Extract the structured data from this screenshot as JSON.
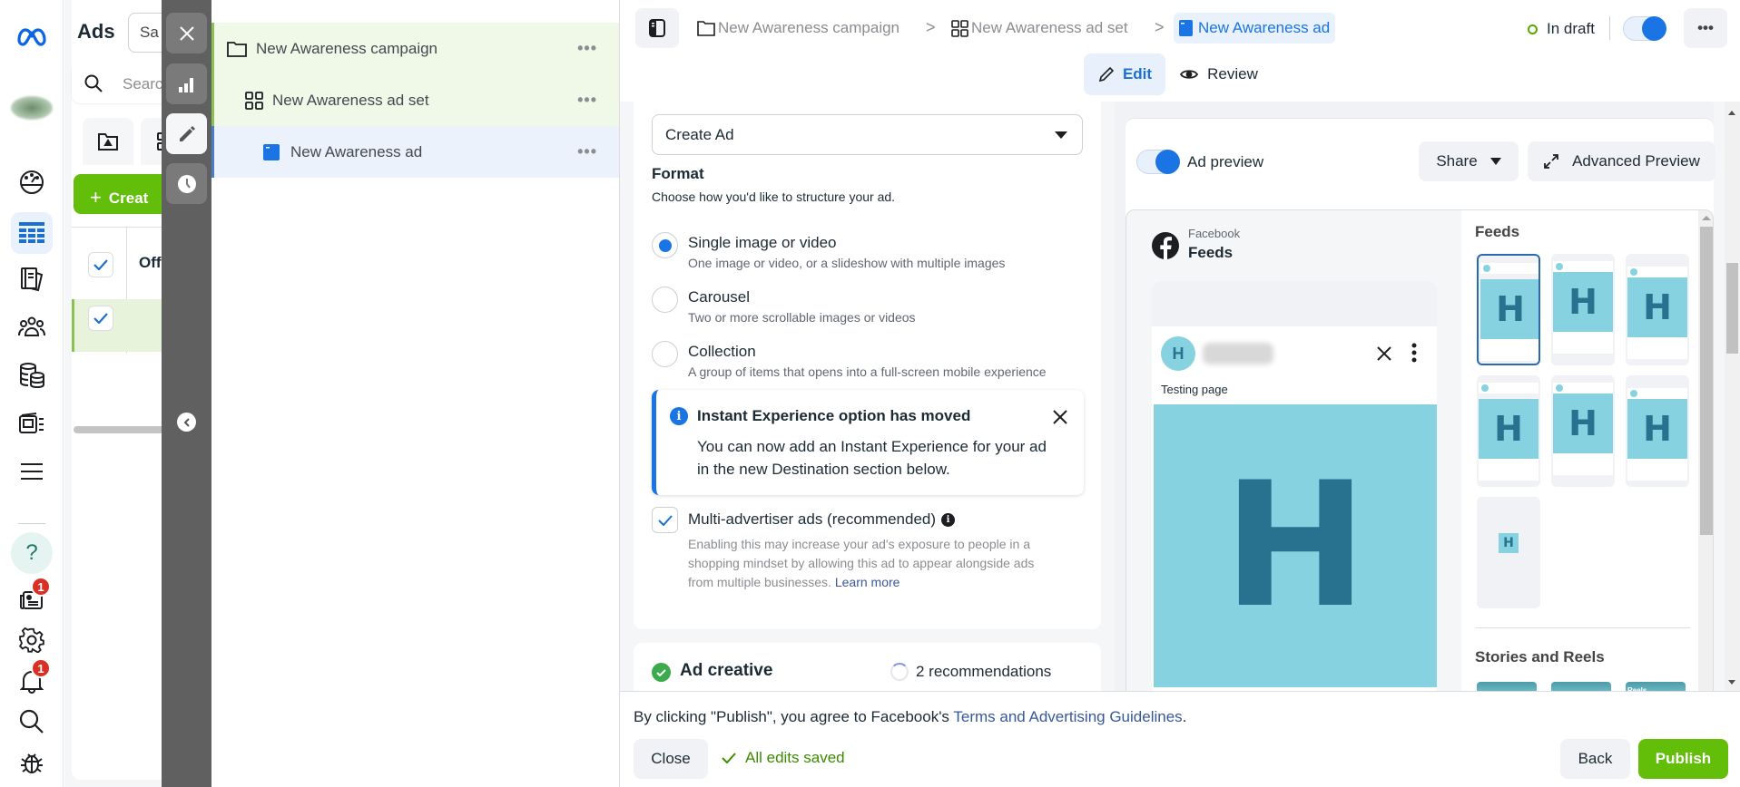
{
  "left_nav": {
    "items": [
      {
        "name": "meta-logo",
        "label": "Meta"
      },
      {
        "name": "account-avatar",
        "label": "Account"
      },
      {
        "name": "dashboard",
        "label": "Overview"
      },
      {
        "name": "ads-manager",
        "label": "Ads Manager",
        "active": true
      },
      {
        "name": "pages",
        "label": "Pages"
      },
      {
        "name": "audiences",
        "label": "Audiences"
      },
      {
        "name": "billing",
        "label": "Billing"
      },
      {
        "name": "media-library",
        "label": "Media"
      },
      {
        "name": "all-tools",
        "label": "All tools"
      },
      {
        "name": "help",
        "label": "Help"
      },
      {
        "name": "news",
        "label": "News",
        "badge": "1"
      },
      {
        "name": "settings",
        "label": "Settings"
      },
      {
        "name": "notifications",
        "label": "Notifications",
        "badge": "1"
      },
      {
        "name": "search",
        "label": "Search"
      },
      {
        "name": "report-bug",
        "label": "Report a problem"
      }
    ]
  },
  "ads_panel": {
    "title": "Ads",
    "saved_dropdown": "Sa",
    "search_placeholder": "Searc",
    "create_label": "Creat",
    "column_off": "Off"
  },
  "rail": {
    "buttons": [
      "close",
      "charts",
      "edit",
      "history"
    ]
  },
  "tree": {
    "campaign": "New Awareness campaign",
    "ad_set": "New Awareness ad set",
    "ad": "New Awareness ad",
    "more": "•••"
  },
  "header": {
    "breadcrumb": [
      {
        "label": "New Awareness campaign",
        "icon": "folder-icon"
      },
      {
        "label": "New Awareness ad set",
        "icon": "grid-icon"
      },
      {
        "label": "New Awareness ad",
        "icon": "ad-icon",
        "current": true
      }
    ],
    "separator": ">",
    "status": "In draft",
    "status_color": "#58a700",
    "toggle_on": true,
    "more": "•••",
    "tabs": [
      {
        "label": "Edit",
        "active": true
      },
      {
        "label": "Review",
        "active": false
      }
    ]
  },
  "form": {
    "create_select": "Create Ad",
    "format_title": "Format",
    "format_subtitle": "Choose how you'd like to structure your ad.",
    "options": [
      {
        "title": "Single image or video",
        "subtitle": "One image or video, or a slideshow with multiple images",
        "selected": true
      },
      {
        "title": "Carousel",
        "subtitle": "Two or more scrollable images or videos",
        "selected": false
      },
      {
        "title": "Collection",
        "subtitle": "A group of items that opens into a full-screen mobile experience",
        "selected": false
      }
    ],
    "notice": {
      "title": "Instant Experience option has moved",
      "body_line1": "You can now add an Instant Experience for your ad",
      "body_line2": "in the new Destination section below."
    },
    "multi_advertiser": {
      "label": "Multi-advertiser ads (recommended)",
      "checked": true,
      "desc_line1": "Enabling this may increase your ad's exposure to people in a",
      "desc_line2": "shopping mindset by allowing this ad to appear alongside ads",
      "desc_line3": "from multiple businesses.",
      "learn_more": "Learn more"
    },
    "ad_creative": {
      "title": "Ad creative",
      "recommendations": "2 recommendations"
    }
  },
  "preview": {
    "toggle_label": "Ad preview",
    "toggle_on": true,
    "share_label": "Share",
    "advanced_label": "Advanced Preview",
    "platform": "Facebook",
    "placement": "Feeds",
    "avatar_letter": "H",
    "post_text": "Testing page",
    "image_letter": "H",
    "image_bg": "#86d2e0",
    "image_fg": "#28728f",
    "sidebar": {
      "feeds_title": "Feeds",
      "thumb_letter": "H",
      "stories_title": "Stories and Reels",
      "reels_label": "Reels"
    }
  },
  "footer": {
    "agree_prefix": "By clicking \"Publish\", you agree to Facebook's ",
    "agree_link": "Terms and Advertising Guidelines",
    "agree_suffix": ".",
    "close_label": "Close",
    "saved_label": "All edits saved",
    "back_label": "Back",
    "publish_label": "Publish",
    "publish_color": "#63be09"
  }
}
